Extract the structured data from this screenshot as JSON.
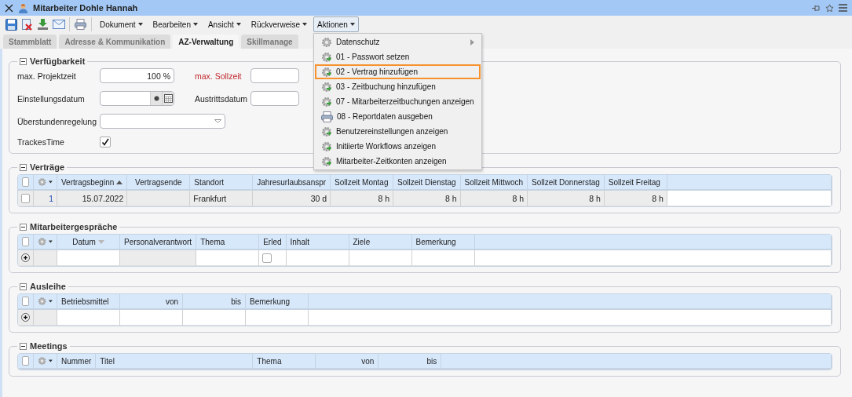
{
  "window": {
    "title": "Mitarbeiter Dohle Hannah"
  },
  "toolbar": {
    "menus": [
      {
        "label": "Dokument",
        "open": false
      },
      {
        "label": "Bearbeiten",
        "open": false
      },
      {
        "label": "Ansicht",
        "open": false
      },
      {
        "label": "Rückverweise",
        "open": false
      },
      {
        "label": "Aktionen",
        "open": true
      }
    ]
  },
  "tabs": [
    {
      "label": "Stammblatt",
      "selected": false
    },
    {
      "label": "Adresse & Kommunikation",
      "selected": false
    },
    {
      "label": "AZ-Verwaltung",
      "selected": true
    },
    {
      "label": "Skillmanage",
      "selected": false
    }
  ],
  "action_menu": {
    "items": [
      {
        "label": "Datenschutz",
        "kind": "gear",
        "submenu": true,
        "highlighted": false
      },
      {
        "label": "01 - Passwort setzen",
        "kind": "run",
        "submenu": false,
        "highlighted": false
      },
      {
        "label": "02 - Vertrag hinzufügen",
        "kind": "run",
        "submenu": false,
        "highlighted": true
      },
      {
        "label": "03 - Zeitbuchung hinzufügen",
        "kind": "run",
        "submenu": false,
        "highlighted": false
      },
      {
        "label": "07 - Mitarbeiterzeitbuchungen anzeigen",
        "kind": "run",
        "submenu": false,
        "highlighted": false
      },
      {
        "label": "08 - Reportdaten ausgeben",
        "kind": "printer",
        "submenu": false,
        "highlighted": false
      },
      {
        "label": "Benutzereinstellungen anzeigen",
        "kind": "run",
        "submenu": false,
        "highlighted": false
      },
      {
        "label": "Initiierte Workflows anzeigen",
        "kind": "run",
        "submenu": false,
        "highlighted": false
      },
      {
        "label": "Mitarbeiter-Zeitkonten anzeigen",
        "kind": "run",
        "submenu": false,
        "highlighted": false
      }
    ]
  },
  "availability": {
    "title": "Verfügbarkeit",
    "expanded": true,
    "fields": [
      {
        "label": "max. Projektzeit",
        "kind": "text",
        "value": "100 %",
        "required": false
      },
      {
        "label": "max. Sollzeit",
        "kind": "text",
        "required": true
      },
      {
        "label": "Einstellungsdatum",
        "kind": "date",
        "required": false
      },
      {
        "label": "Austrittsdatum",
        "kind": "text",
        "required": false
      },
      {
        "label": "Überstundenregelung",
        "kind": "select",
        "required": false
      },
      {
        "label": "TrackesTime",
        "kind": "check",
        "checked": true,
        "required": false
      }
    ]
  },
  "sections": [
    {
      "title": "Verträge",
      "expanded": true,
      "all_checked": false,
      "columns": [
        {
          "label": "Vertragsbeginn",
          "kind": "date",
          "sorted": true,
          "descending": false
        },
        {
          "label": "Vertragsende",
          "kind": "date",
          "sorted": false
        },
        {
          "label": "Standort",
          "kind": "text",
          "sorted": false
        },
        {
          "label": "Jahresurlaubsanspr",
          "kind": "amount",
          "sorted": false
        },
        {
          "label": "Sollzeit Montag",
          "kind": "amount",
          "sorted": false
        },
        {
          "label": "Sollzeit Dienstag",
          "kind": "amount",
          "sorted": false
        },
        {
          "label": "Sollzeit Mittwoch",
          "kind": "amount",
          "sorted": false
        },
        {
          "label": "Sollzeit Donnerstag",
          "kind": "amount",
          "sorted": false
        },
        {
          "label": "Sollzeit Freitag",
          "kind": "amount",
          "sorted": false
        }
      ],
      "rows": [
        {
          "kind": "data",
          "checked": false,
          "number": "1",
          "cells": [
            "15.07.2022",
            "",
            "Frankfurt",
            "30 d",
            "8 h",
            "8 h",
            "8 h",
            "8 h",
            "8 h"
          ]
        }
      ]
    },
    {
      "title": "Mitarbeitergespräche",
      "expanded": true,
      "all_checked": false,
      "columns": [
        {
          "label": "Datum",
          "kind": "date",
          "sorted": true,
          "descending": true,
          "readonly": false
        },
        {
          "label": "Personalverantwort",
          "kind": "text",
          "sorted": false,
          "readonly": true
        },
        {
          "label": "Thema",
          "kind": "text",
          "sorted": false,
          "readonly": false
        },
        {
          "label": "Erled",
          "kind": "check",
          "sorted": false,
          "readonly": false
        },
        {
          "label": "Inhalt",
          "kind": "text",
          "sorted": false,
          "readonly": false
        },
        {
          "label": "Ziele",
          "kind": "text",
          "sorted": false,
          "readonly": false
        },
        {
          "label": "Bemerkung",
          "kind": "text",
          "sorted": false,
          "readonly": false
        }
      ],
      "rows": [
        {
          "kind": "new",
          "done": false
        }
      ]
    },
    {
      "title": "Ausleihe",
      "expanded": true,
      "all_checked": false,
      "columns": [
        {
          "label": "Betriebsmittel",
          "kind": "text"
        },
        {
          "label": "von",
          "kind": "date"
        },
        {
          "label": "bis",
          "kind": "date"
        },
        {
          "label": "Bemerkung",
          "kind": "text"
        }
      ],
      "rows": [
        {
          "kind": "new"
        }
      ]
    },
    {
      "title": "Meetings",
      "expanded": true,
      "all_checked": false,
      "columns": [
        {
          "label": "Nummer",
          "kind": "number"
        },
        {
          "label": "Titel",
          "kind": "title"
        },
        {
          "label": "Thema",
          "kind": "text"
        },
        {
          "label": "von",
          "kind": "date"
        },
        {
          "label": "bis",
          "kind": "date"
        }
      ]
    }
  ]
}
